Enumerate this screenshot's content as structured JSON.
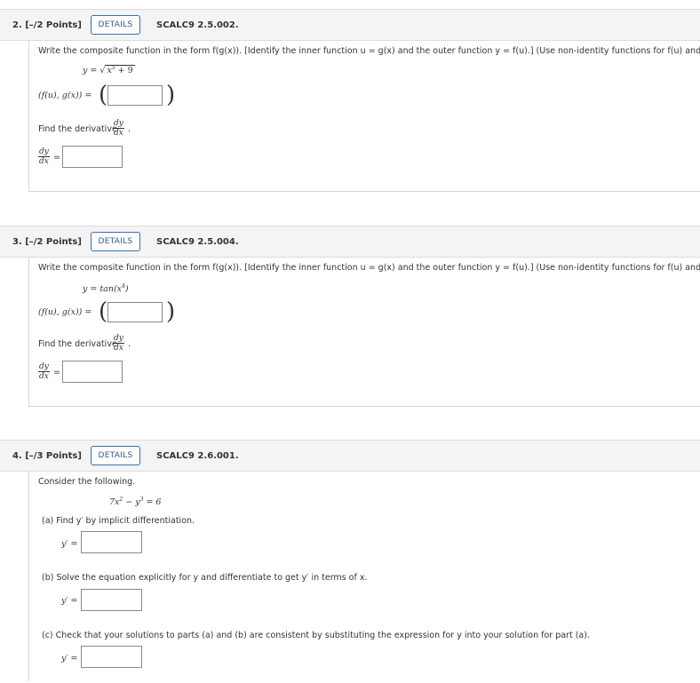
{
  "q2": {
    "number": "2. [–/2 Points]",
    "details_label": "DETAILS",
    "code": "SCALC9 2.5.002.",
    "instruction": "Write the composite function in the form f(g(x)). [Identify the inner function u = g(x) and the outer function y = f(u).] (Use non-identity functions for f(u) and g(x).)",
    "equation_lhs": "y =",
    "radicand_base": "x",
    "radicand_exp": "5",
    "radicand_rest": " + 9",
    "pair_label": "(f(u), g(x)) =",
    "derivative_prompt": "Find the derivative",
    "frac_num": "dy",
    "frac_den": "dx",
    "period": ".",
    "equals": "=",
    "pair_value": "",
    "derivative_value": ""
  },
  "q3": {
    "number": "3. [–/2 Points]",
    "details_label": "DETAILS",
    "code": "SCALC9 2.5.004.",
    "instruction": "Write the composite function in the form f(g(x)). [Identify the inner function u = g(x) and the outer function y = f(u).] (Use non-identity functions for f(u) and g(x).)",
    "equation_pre": "y = tan(x",
    "equation_exp": "4",
    "equation_post": ")",
    "pair_label": "(f(u), g(x)) =",
    "derivative_prompt": "Find the derivative",
    "frac_num": "dy",
    "frac_den": "dx",
    "period": ".",
    "equals": "=",
    "pair_value": "",
    "derivative_value": ""
  },
  "q4": {
    "number": "4. [–/3 Points]",
    "details_label": "DETAILS",
    "code": "SCALC9 2.6.001.",
    "intro": "Consider the following.",
    "eq_a": "7x",
    "eq_a_exp": "2",
    "eq_b": " − y",
    "eq_b_exp": "3",
    "eq_c": " = 6",
    "part_a": "(a)  Find y′ by implicit differentiation.",
    "part_b": "(b)  Solve the equation explicitly for y and differentiate to get y′ in terms of x.",
    "part_c": "(c)  Check that your solutions to parts (a) and (b) are consistent by substituting the expression for y into your solution for part (a).",
    "y_prime_label": "y′ =",
    "a_value": "",
    "b_value": "",
    "c_value": ""
  }
}
